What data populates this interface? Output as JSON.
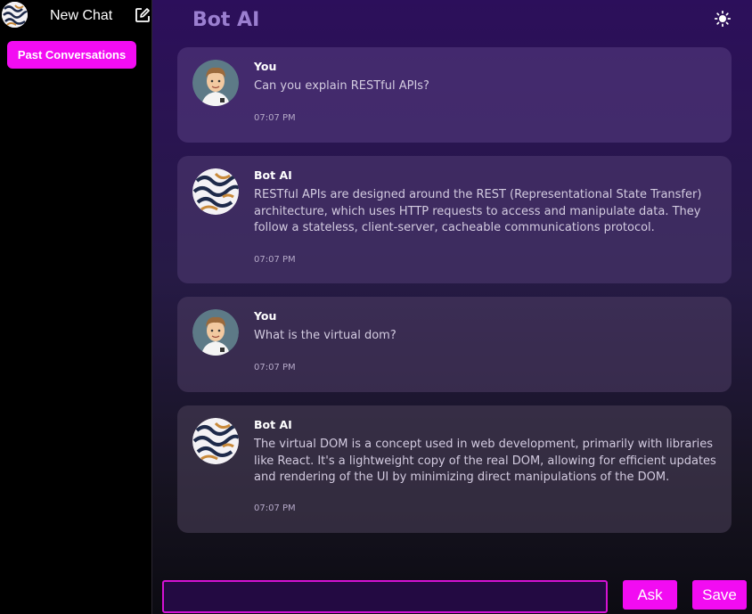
{
  "sidebar": {
    "new_chat_label": "New Chat",
    "past_conversations_label": "Past Conversations"
  },
  "header": {
    "title": "Bot AI"
  },
  "messages": [
    {
      "sender": "You",
      "text": "Can you explain RESTful APIs?",
      "time": "07:07 PM",
      "avatar": "user-avatar"
    },
    {
      "sender": "Bot AI",
      "text": "RESTful APIs are designed around the REST (Representational State Transfer) architecture, which uses HTTP requests to access and manipulate data. They follow a stateless, client-server, cacheable communications protocol.",
      "time": "07:07 PM",
      "avatar": "bot-avatar"
    },
    {
      "sender": "You",
      "text": "What is the virtual dom?",
      "time": "07:07 PM",
      "avatar": "user-avatar"
    },
    {
      "sender": "Bot AI",
      "text": "The virtual DOM is a concept used in web development, primarily with libraries like React. It's a lightweight copy of the real DOM, allowing for efficient updates and rendering of the UI by minimizing direct manipulations of the DOM.",
      "time": "07:07 PM",
      "avatar": "bot-avatar"
    }
  ],
  "composer": {
    "input_value": "",
    "ask_label": "Ask",
    "save_label": "Save"
  },
  "colors": {
    "accent": "#f20cf2",
    "title": "#9b7fd0"
  }
}
